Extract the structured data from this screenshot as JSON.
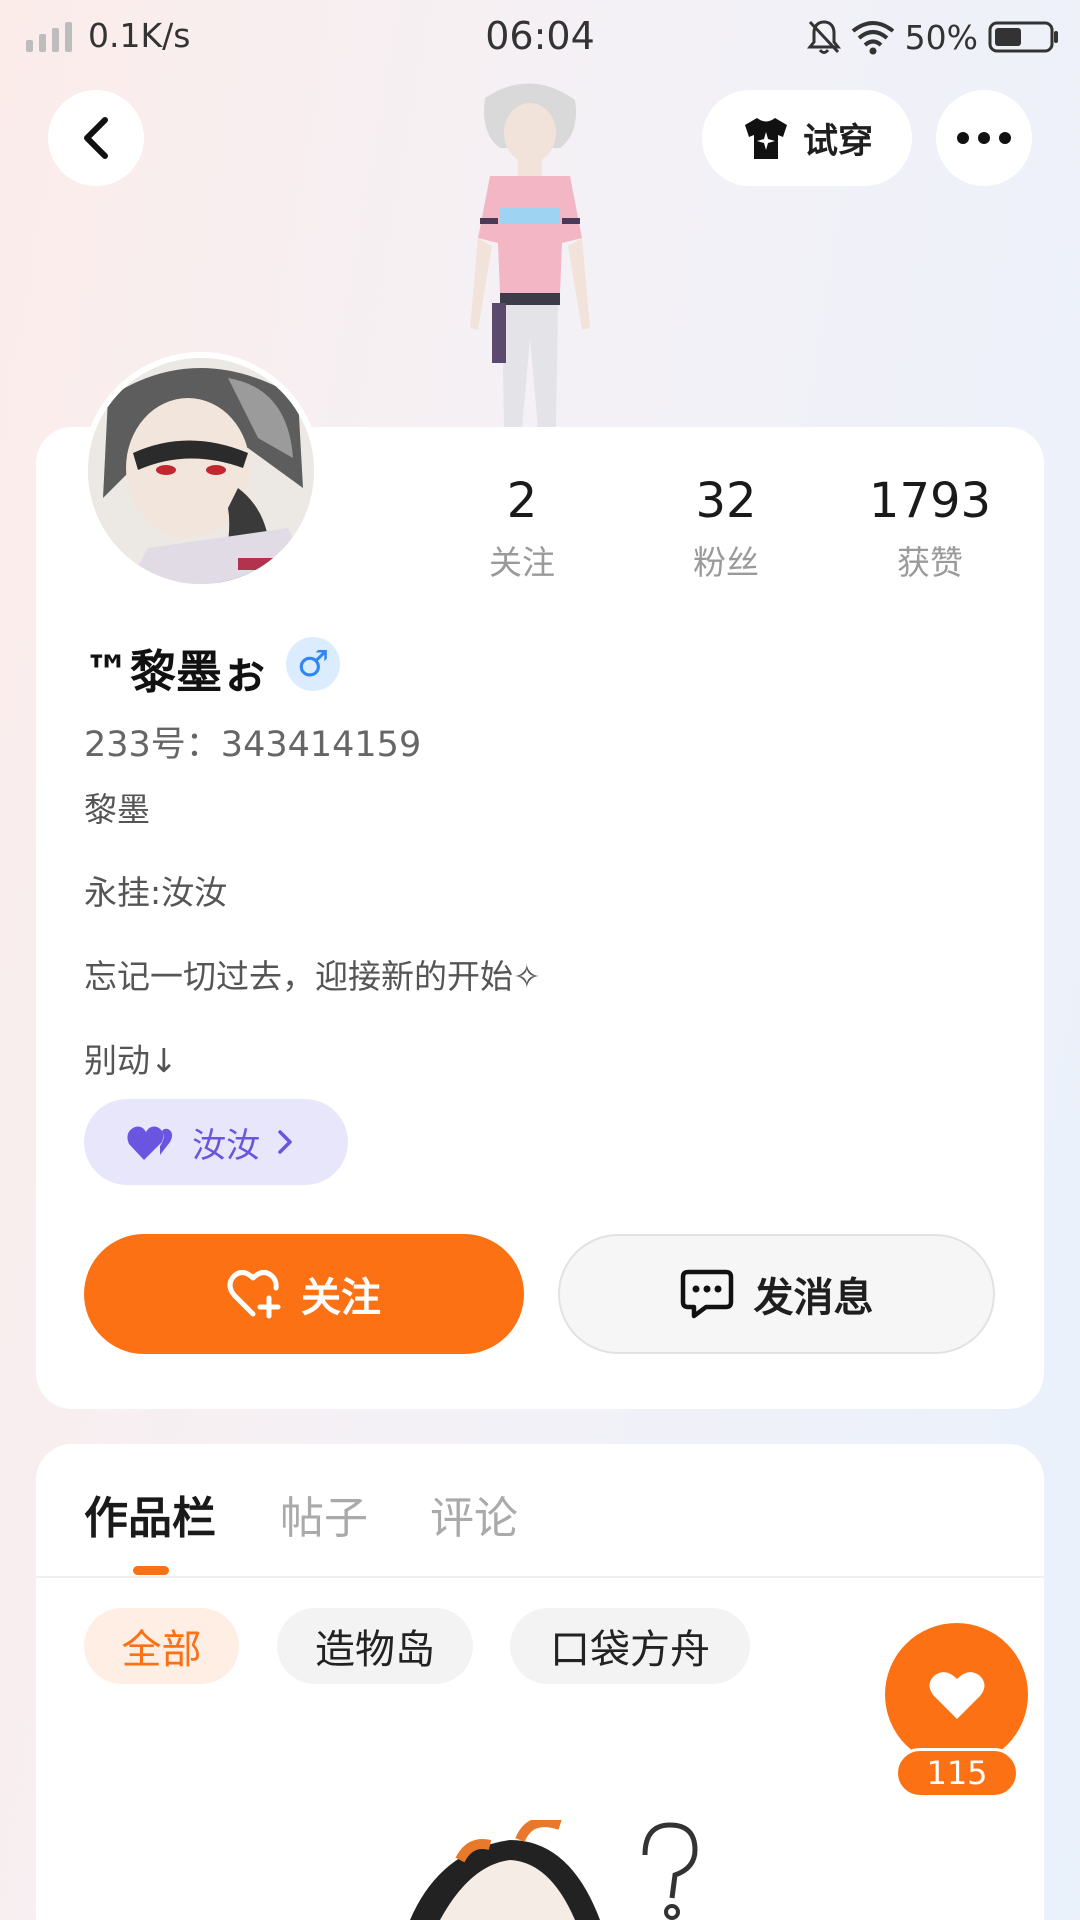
{
  "status_bar": {
    "net_speed": "0.1K/s",
    "time": "06:04",
    "battery_pct": "50%",
    "battery_level": 0.5,
    "icons": [
      "signal-icon",
      "mute-bell-icon",
      "wifi-icon",
      "battery-icon"
    ]
  },
  "top_bar": {
    "try_on_label": "试穿",
    "icons": [
      "back-chevron-icon",
      "tshirt-icon",
      "more-dots-icon"
    ]
  },
  "profile": {
    "username": "™黎墨ぉ",
    "gender_symbol": "♂",
    "uid_text": "233号：343414159",
    "stats": [
      {
        "value": "2",
        "label": "关注"
      },
      {
        "value": "32",
        "label": "粉丝"
      },
      {
        "value": "1793",
        "label": "获赞"
      }
    ],
    "bio": [
      "黎墨",
      "永挂:汝汝",
      "忘记一切过去，迎接新的开始✧",
      "别动↓"
    ],
    "partner_label": "汝汝",
    "follow_label": "关注",
    "message_label": "发消息"
  },
  "content": {
    "tabs": [
      {
        "label": "作品栏",
        "active": true
      },
      {
        "label": "帖子",
        "active": false
      },
      {
        "label": "评论",
        "active": false
      }
    ],
    "filters": [
      {
        "label": "全部",
        "active": true
      },
      {
        "label": "造物岛",
        "active": false
      },
      {
        "label": "口袋方舟",
        "active": false
      }
    ],
    "like_count": "115"
  },
  "colors": {
    "accent": "#fd7115",
    "partner_purple": "#6a55e0",
    "gender_blue": "#2f86f6"
  }
}
